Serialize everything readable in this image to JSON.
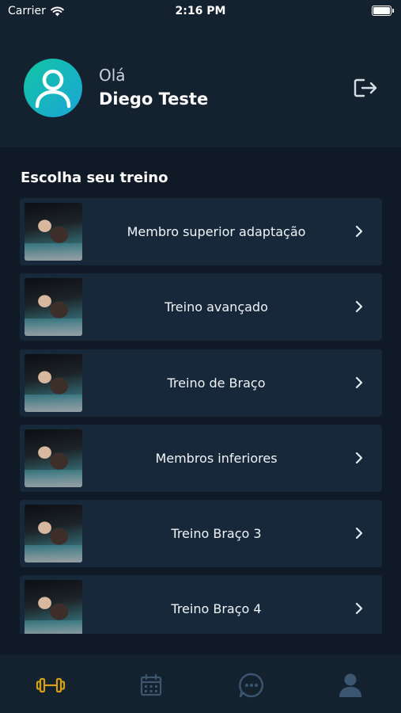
{
  "status_bar": {
    "carrier": "Carrier",
    "time": "2:16 PM"
  },
  "header": {
    "greeting": "Olá",
    "user_name": "Diego Teste",
    "logout_icon": "logout-icon",
    "avatar_icon": "user-icon"
  },
  "section_title": "Escolha seu treino",
  "workouts": [
    {
      "label": "Membro superior adaptação"
    },
    {
      "label": "Treino avançado"
    },
    {
      "label": "Treino de Braço"
    },
    {
      "label": "Membros inferiores"
    },
    {
      "label": "Treino Braço 3"
    },
    {
      "label": "Treino Braço 4"
    }
  ],
  "tabbar": {
    "tabs": [
      {
        "icon": "dumbbell-icon",
        "active": true
      },
      {
        "icon": "calendar-icon",
        "active": false
      },
      {
        "icon": "chat-icon",
        "active": false
      },
      {
        "icon": "profile-icon",
        "active": false
      }
    ]
  },
  "colors": {
    "background": "#0f1a26",
    "header_background": "#142230",
    "card_background": "#16283a",
    "active_tab": "#d4a017",
    "inactive_tab": "#3c5670",
    "avatar_gradient_start": "#12c4a3",
    "avatar_gradient_end": "#1aa6d8"
  }
}
